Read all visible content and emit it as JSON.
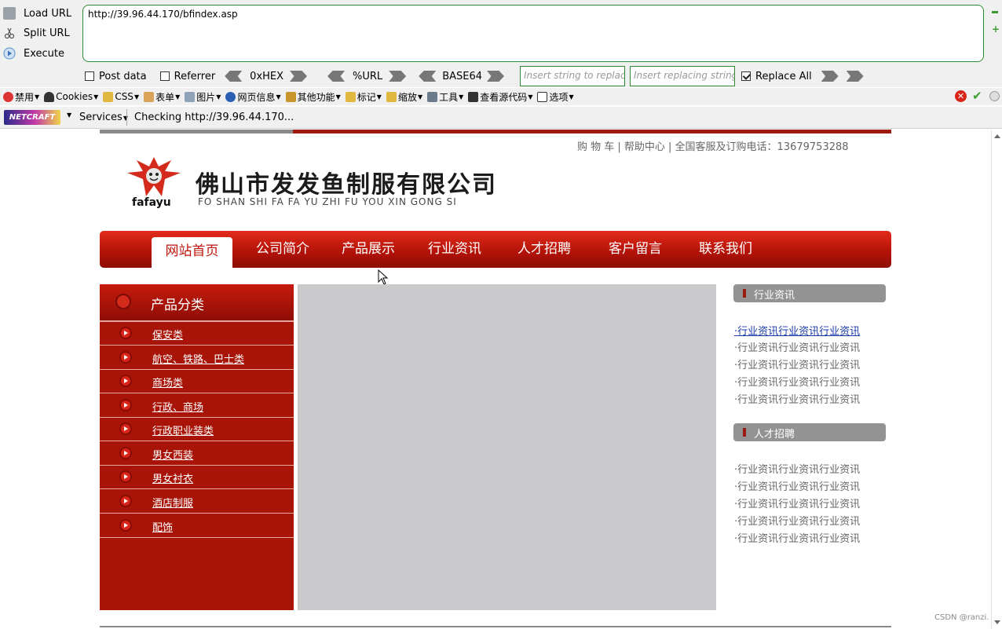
{
  "hackbar": {
    "actions": [
      "Load URL",
      "Split URL",
      "Execute"
    ],
    "url": "http://39.96.44.170/bfindex.asp",
    "post_data": "Post data",
    "referrer": "Referrer",
    "hex": "0xHEX",
    "url_enc": "%URL",
    "base64": "BASE64",
    "replace_placeholder": "Insert string to replace",
    "replacing_placeholder": "Insert replacing string",
    "replace_all": "Replace All"
  },
  "toolbar": {
    "items": [
      "禁用",
      "Cookies",
      "CSS",
      "表单",
      "图片",
      "网页信息",
      "其他功能",
      "标记",
      "缩放",
      "工具",
      "查看源代码",
      "选项"
    ],
    "netcraft": "NETCRAFT",
    "services": "Services",
    "status": "Checking http://39.96.44.170..."
  },
  "site": {
    "top_links": "购 物 车 | 帮助中心 | 全国客服及订购电话：13679753288",
    "logo_text": "fafayu",
    "company_name": "佛山市发发鱼制服有限公司",
    "company_pinyin": "FO SHAN SHI FA FA YU ZHI FU YOU XIN GONG SI",
    "nav": [
      "网站首页",
      "公司简介",
      "产品展示",
      "行业资讯",
      "人才招聘",
      "客户留言",
      "联系我们"
    ],
    "sidebar_title": "产品分类",
    "categories": [
      "保安类",
      "航空、铁路、巴士类",
      "商场类",
      "行政、商场",
      "行政职业装类",
      "男女西装",
      "男女衬衣",
      "酒店制服",
      "配饰"
    ],
    "news_title": "行业资讯",
    "news_items": [
      "行业资讯行业资讯行业资讯",
      "行业资讯行业资讯行业资讯",
      "行业资讯行业资讯行业资讯",
      "行业资讯行业资讯行业资讯",
      "行业资讯行业资讯行业资讯"
    ],
    "jobs_title": "人才招聘",
    "jobs_items": [
      "行业资讯行业资讯行业资讯",
      "行业资讯行业资讯行业资讯",
      "行业资讯行业资讯行业资讯",
      "行业资讯行业资讯行业资讯",
      "行业资讯行业资讯行业资讯"
    ]
  },
  "watermark": "CSDN @ranzi.",
  "colors": {
    "brand_red": "#b01208",
    "hackbar_green": "#2e8b2e"
  }
}
